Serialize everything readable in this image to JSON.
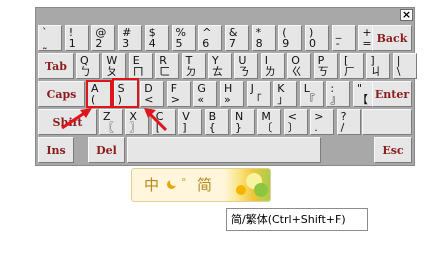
{
  "keyboard": {
    "close": "×",
    "row1": [
      {
        "t": "`",
        "b": "˷"
      },
      {
        "t": "!",
        "b": "1"
      },
      {
        "t": "@",
        "b": "2"
      },
      {
        "t": "#",
        "b": "3"
      },
      {
        "t": "$",
        "b": "4"
      },
      {
        "t": "%",
        "b": "5"
      },
      {
        "t": "^",
        "b": "6"
      },
      {
        "t": "&",
        "b": "7"
      },
      {
        "t": "*",
        "b": "8"
      },
      {
        "t": "(",
        "b": "9"
      },
      {
        "t": ")",
        "b": "0"
      },
      {
        "t": "_",
        "b": "-"
      },
      {
        "t": "+",
        "b": "="
      }
    ],
    "backspace": "Back",
    "tab": "Tab",
    "row2": [
      {
        "t": "Q",
        "b": "ㄅ"
      },
      {
        "t": "W",
        "b": "ㄆ"
      },
      {
        "t": "E",
        "b": "ㄇ"
      },
      {
        "t": "R",
        "b": "ㄈ"
      },
      {
        "t": "T",
        "b": "ㄉ"
      },
      {
        "t": "Y",
        "b": "ㄊ"
      },
      {
        "t": "U",
        "b": "ㄋ"
      },
      {
        "t": "I",
        "b": "ㄌ"
      },
      {
        "t": "O",
        "b": "ㄍ"
      },
      {
        "t": "P",
        "b": "ㄎ"
      },
      {
        "t": "[",
        "b": "ㄏ"
      },
      {
        "t": "]",
        "b": "ㄐ"
      },
      {
        "t": "|",
        "b": "\\"
      }
    ],
    "caps": "Caps",
    "row3": [
      {
        "t": "A",
        "b": "("
      },
      {
        "t": "S",
        "b": ")"
      },
      {
        "t": "D",
        "b": "<"
      },
      {
        "t": "F",
        "b": ">"
      },
      {
        "t": "G",
        "b": "«"
      },
      {
        "t": "H",
        "b": "»"
      },
      {
        "t": "J",
        "b": "「"
      },
      {
        "t": "K",
        "b": "」"
      },
      {
        "t": "L",
        "b": "『"
      },
      {
        "t": ":",
        "b": "』"
      },
      {
        "t": "\"",
        "b": "【"
      }
    ],
    "enter": "Enter",
    "shift": "Shift",
    "row4": [
      {
        "t": "Z",
        "b": "〖"
      },
      {
        "t": "X",
        "b": "〗"
      },
      {
        "t": "C",
        "b": "["
      },
      {
        "t": "V",
        "b": "]"
      },
      {
        "t": "B",
        "b": "{"
      },
      {
        "t": "N",
        "b": "}"
      },
      {
        "t": "M",
        "b": "〔"
      },
      {
        "t": "<",
        "b": "〕"
      },
      {
        "t": ">",
        "b": "."
      },
      {
        "t": "?",
        "b": "/"
      }
    ],
    "ins": "Ins",
    "del": "Del",
    "esc": "Esc"
  },
  "ime_status": {
    "mode": "中",
    "punct": "°",
    "charset": "简",
    "colors": {
      "accent": "#b58a1c",
      "moon": "#e5a813"
    }
  },
  "tooltip": "简/繁体(Ctrl+Shift+F)",
  "colors": {
    "highlight": "#e0151c",
    "keyword": "#8b1c1c",
    "keyboard_bg": "#a8a8a8"
  }
}
